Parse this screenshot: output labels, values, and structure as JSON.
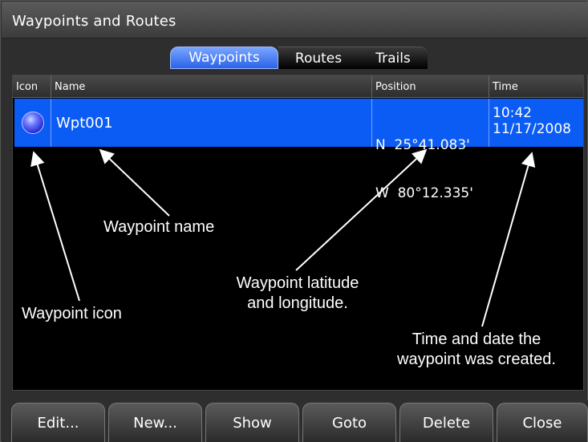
{
  "window": {
    "title": "Waypoints and Routes"
  },
  "tabs": [
    {
      "label": "Waypoints",
      "active": true
    },
    {
      "label": "Routes",
      "active": false
    },
    {
      "label": "Trails",
      "active": false
    }
  ],
  "table": {
    "headers": {
      "icon": "Icon",
      "name": "Name",
      "position": "Position",
      "time": "Time"
    },
    "rows": [
      {
        "icon": "waypoint-orb-icon",
        "name": "Wpt001",
        "lat": "N  25°41.083'",
        "lon": "W  80°12.335'",
        "time": "10:42",
        "date": "11/17/2008"
      }
    ]
  },
  "annotations": {
    "name": "Waypoint name",
    "icon": "Waypoint icon",
    "position_line1": "Waypoint latitude",
    "position_line2": "and longitude.",
    "time_line1": "Time and date the",
    "time_line2": "waypoint was created."
  },
  "buttons": {
    "edit": "Edit...",
    "new": "New...",
    "show": "Show",
    "goto": "Goto",
    "delete": "Delete",
    "close": "Close"
  },
  "colors": {
    "selection": "#0a5cf5",
    "active_tab": "#2a63e8",
    "background": "#2e2e2e",
    "list_background": "#000000"
  }
}
